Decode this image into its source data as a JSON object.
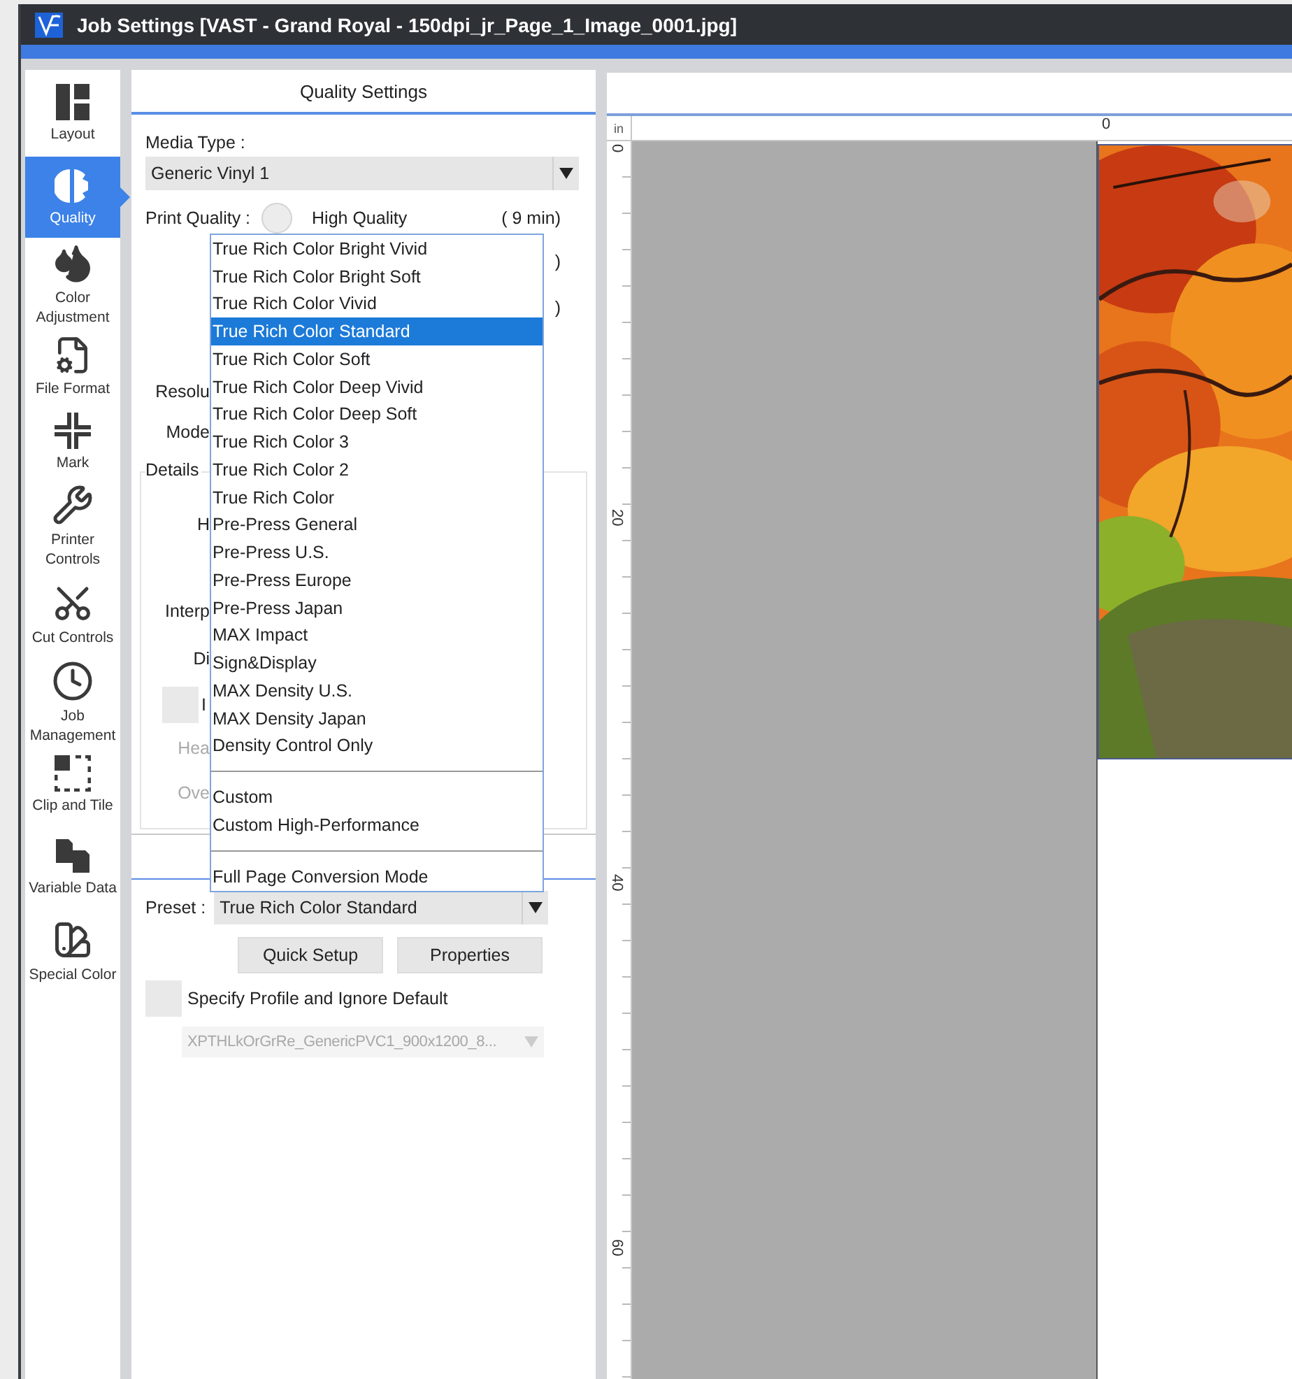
{
  "window": {
    "title": "Job Settings [VAST - Grand Royal - 150dpi_jr_Page_1_Image_0001.jpg]"
  },
  "sidebar": {
    "items": [
      {
        "label": "Layout",
        "selected": false
      },
      {
        "label": "Quality",
        "selected": true
      },
      {
        "label": "Color Adjustment",
        "selected": false
      },
      {
        "label": "File Format",
        "selected": false
      },
      {
        "label": "Mark",
        "selected": false
      },
      {
        "label": "Printer Controls",
        "selected": false
      },
      {
        "label": "Cut Controls",
        "selected": false
      },
      {
        "label": "Job Management",
        "selected": false
      },
      {
        "label": "Clip and Tile",
        "selected": false
      },
      {
        "label": "Variable Data",
        "selected": false
      },
      {
        "label": "Special Color",
        "selected": false
      }
    ]
  },
  "quality_panel": {
    "title": "Quality Settings",
    "media_type": {
      "label": "Media Type :",
      "value": "Generic Vinyl 1"
    },
    "print_quality": {
      "label": "Print Quality :",
      "options": [
        {
          "label": "High Quality",
          "time": "( 9 min)",
          "selected": false
        }
      ],
      "covered_times": [
        ")",
        ")"
      ]
    },
    "covered_labels": [
      "Resolu",
      "Mode"
    ],
    "details": {
      "title": "Details",
      "rows": [
        {
          "kind": "label",
          "text": "H",
          "disabled": false
        },
        {
          "kind": "label",
          "text": "Interp",
          "disabled": false
        },
        {
          "kind": "label",
          "text": "Di",
          "disabled": false
        },
        {
          "kind": "checkbox",
          "text": "I",
          "checked": false,
          "disabled": false
        },
        {
          "kind": "label",
          "text": "Hea",
          "disabled": true
        },
        {
          "kind": "label",
          "text": "Ove",
          "disabled": true
        }
      ]
    },
    "preset": {
      "label": "Preset :",
      "value": "True Rich Color Standard"
    },
    "buttons": [
      "Quick Setup",
      "Properties"
    ],
    "profile": {
      "label": "Specify Profile and Ignore Default",
      "checked": false,
      "value": "XPTHLkOrGrRe_GenericPVC1_900x1200_8...",
      "disabled": true
    }
  },
  "dropdown": {
    "groups": [
      {
        "items": [
          {
            "label": "True Rich Color Bright Vivid",
            "selected": false
          },
          {
            "label": "True Rich Color Bright Soft",
            "selected": false
          },
          {
            "label": "True Rich Color Vivid",
            "selected": false
          },
          {
            "label": "True Rich Color Standard",
            "selected": true
          },
          {
            "label": "True Rich Color Soft",
            "selected": false
          },
          {
            "label": "True Rich Color Deep Vivid",
            "selected": false
          },
          {
            "label": "True Rich Color Deep Soft",
            "selected": false
          },
          {
            "label": "True Rich Color 3",
            "selected": false
          },
          {
            "label": "True Rich Color 2",
            "selected": false
          },
          {
            "label": "True Rich Color",
            "selected": false
          },
          {
            "label": "Pre-Press General",
            "selected": false
          },
          {
            "label": "Pre-Press U.S.",
            "selected": false
          },
          {
            "label": "Pre-Press Europe",
            "selected": false
          },
          {
            "label": "Pre-Press Japan",
            "selected": false
          },
          {
            "label": "MAX Impact",
            "selected": false
          },
          {
            "label": "Sign&Display",
            "selected": false
          },
          {
            "label": "MAX Density U.S.",
            "selected": false
          },
          {
            "label": "MAX Density Japan",
            "selected": false
          },
          {
            "label": "Density Control Only",
            "selected": false
          }
        ]
      },
      {
        "items": [
          {
            "label": "Custom",
            "selected": false
          },
          {
            "label": "Custom High-Performance",
            "selected": false
          }
        ]
      },
      {
        "items": [
          {
            "label": "Full Page Conversion Mode",
            "selected": false
          }
        ]
      }
    ]
  },
  "preview": {
    "unit": "in",
    "h_ruler": [
      "0"
    ],
    "v_ruler": [
      "0",
      "20",
      "40",
      "60"
    ],
    "image": {
      "kind": "picture"
    }
  }
}
